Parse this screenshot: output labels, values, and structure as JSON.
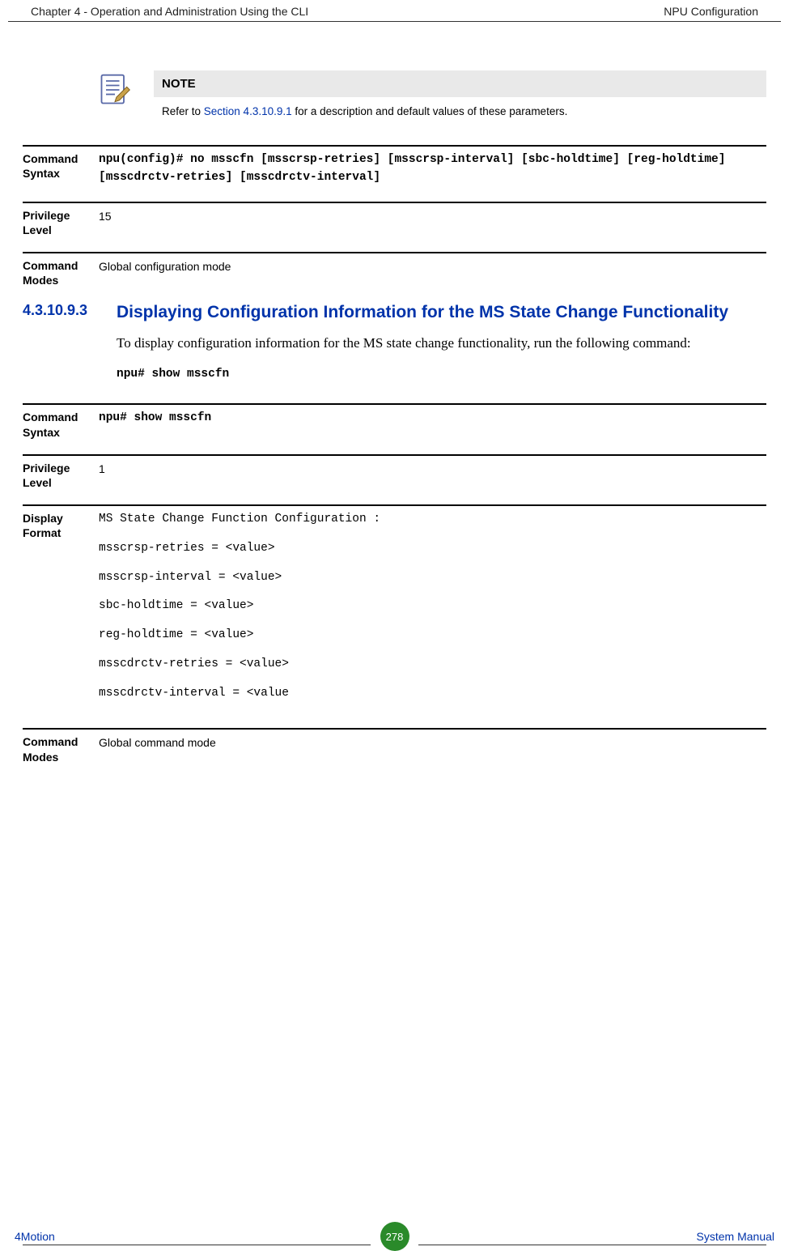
{
  "header": {
    "left": "Chapter 4 - Operation and Administration Using the CLI",
    "right": "NPU Configuration"
  },
  "note": {
    "label": "NOTE",
    "text_pre": "Refer to ",
    "link": "Section 4.3.10.9.1",
    "text_post": " for a description and default values of these parameters."
  },
  "blocks1": {
    "cmd_syntax_label": "Command Syntax",
    "cmd_syntax_body": "npu(config)# no msscfn [msscrsp-retries] [msscrsp-interval] [sbc-holdtime] [reg-holdtime] [msscdrctv-retries] [msscdrctv-interval]",
    "priv_label": "Privilege Level",
    "priv_value": "15",
    "modes_label": "Command Modes",
    "modes_value": "Global configuration mode"
  },
  "section": {
    "num": "4.3.10.9.3",
    "title": "Displaying Configuration Information for the MS State Change Functionality",
    "para": "To display configuration information for the MS state change functionality, run the following command:",
    "cmd": "npu# show msscfn"
  },
  "blocks2": {
    "cmd_syntax_label": "Command Syntax",
    "cmd_syntax_body": "npu# show msscfn",
    "priv_label": "Privilege Level",
    "priv_value": "1",
    "display_label": "Display Format",
    "display_lines": [
      "MS State Change Function Configuration :",
      "msscrsp-retries = <value>",
      "msscrsp-interval = <value>",
      "sbc-holdtime = <value>",
      "reg-holdtime = <value>",
      "msscdrctv-retries = <value>",
      "msscdrctv-interval = <value"
    ],
    "modes_label": "Command Modes",
    "modes_value": "Global command mode"
  },
  "footer": {
    "left": "4Motion",
    "page": "278",
    "right": "System Manual"
  }
}
